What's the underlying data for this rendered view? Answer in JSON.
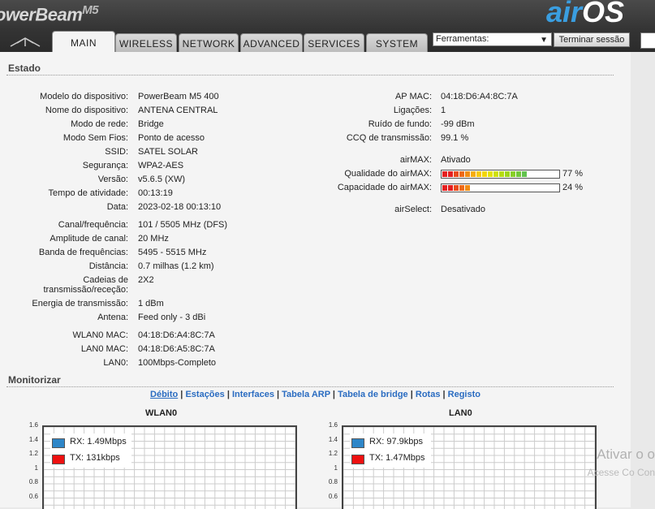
{
  "header": {
    "brand": "owerBeam",
    "brand_model": "M5",
    "logo_air": "air",
    "logo_os": "OS"
  },
  "tabs": [
    {
      "label": "MAIN",
      "active": true
    },
    {
      "label": "WIRELESS",
      "active": false
    },
    {
      "label": "NETWORK",
      "active": false
    },
    {
      "label": "ADVANCED",
      "active": false
    },
    {
      "label": "SERVICES",
      "active": false
    },
    {
      "label": "SYSTEM",
      "active": false
    }
  ],
  "tools": {
    "selected": "Ferramentas:"
  },
  "logout_label": "Terminar sessão",
  "status": {
    "title": "Estado",
    "left": [
      {
        "label": "Modelo do dispositivo:",
        "value": "PowerBeam M5 400"
      },
      {
        "label": "Nome do dispositivo:",
        "value": "ANTENA CENTRAL"
      },
      {
        "label": "Modo de rede:",
        "value": "Bridge"
      },
      {
        "label": "Modo Sem Fios:",
        "value": "Ponto de acesso"
      },
      {
        "label": "SSID:",
        "value": "SATEL SOLAR"
      },
      {
        "label": "Segurança:",
        "value": "WPA2-AES"
      },
      {
        "label": "Versão:",
        "value": "v5.6.5 (XW)"
      },
      {
        "label": "Tempo de atividade:",
        "value": "00:13:19"
      },
      {
        "label": "Data:",
        "value": "2023-02-18 00:13:10"
      },
      {
        "label": "Canal/frequência:",
        "value": "101 / 5505 MHz (DFS)"
      },
      {
        "label": "Amplitude de canal:",
        "value": "20 MHz"
      },
      {
        "label": "Banda de frequências:",
        "value": "5495 - 5515 MHz"
      },
      {
        "label": "Distância:",
        "value": "0.7 milhas (1.2 km)"
      },
      {
        "label": "Cadeias de",
        "label2": "transmissão/receção:",
        "value": "2X2"
      },
      {
        "label": "Energia de transmissão:",
        "value": "1 dBm"
      },
      {
        "label": "Antena:",
        "value": "Feed only - 3 dBi"
      },
      {
        "label": "WLAN0 MAC:",
        "value": "04:18:D6:A4:8C:7A"
      },
      {
        "label": "LAN0 MAC:",
        "value": "04:18:D6:A5:8C:7A"
      },
      {
        "label": "LAN0:",
        "value": "100Mbps-Completo"
      }
    ],
    "right": [
      {
        "label": "AP MAC:",
        "value": "04:18:D6:A4:8C:7A"
      },
      {
        "label": "Ligações:",
        "value": "1"
      },
      {
        "label": "Ruído de fundo:",
        "value": "-99 dBm"
      },
      {
        "label": "CCQ de transmissão:",
        "value": "99.1 %"
      },
      {
        "label": "airMAX:",
        "value": "Ativado"
      },
      {
        "label": "Qualidade do airMAX:",
        "value": "77 %",
        "level": 0.77
      },
      {
        "label": "Capacidade do airMAX:",
        "value": "24 %",
        "level": 0.24
      },
      {
        "label": "airSelect:",
        "value": "Desativado"
      }
    ]
  },
  "monitor": {
    "title": "Monitorizar",
    "links": [
      "Débito",
      "Estações",
      "Interfaces",
      "Tabela ARP",
      "Tabela de bridge",
      "Rotas",
      "Registo"
    ]
  },
  "charts": [
    {
      "title": "WLAN0",
      "legend": [
        {
          "label": "RX: 1.49Mbps",
          "color": "#2e86c8"
        },
        {
          "label": "TX: 131kbps",
          "color": "#ee1111"
        }
      ]
    },
    {
      "title": "LAN0",
      "legend": [
        {
          "label": "RX: 97.9kbps",
          "color": "#2e86c8"
        },
        {
          "label": "TX: 1.47Mbps",
          "color": "#ee1111"
        }
      ]
    }
  ],
  "chart_data": [
    {
      "type": "line",
      "title": "WLAN0",
      "y_ticks": [
        "1.6",
        "1.4",
        "1.2",
        "1",
        "0.8",
        "0.6"
      ],
      "series": [
        {
          "name": "RX: 1.49Mbps",
          "values": []
        },
        {
          "name": "TX: 131kbps",
          "values": []
        }
      ]
    },
    {
      "type": "line",
      "title": "LAN0",
      "y_ticks": [
        "1.6",
        "1.4",
        "1.2",
        "1",
        "0.8",
        "0.6"
      ],
      "series": [
        {
          "name": "RX: 97.9kbps",
          "values": []
        },
        {
          "name": "TX: 1.47Mbps",
          "values": []
        }
      ]
    }
  ],
  "watermark": {
    "line1": "Ativar o o",
    "line2": "Acesse Co Con"
  }
}
